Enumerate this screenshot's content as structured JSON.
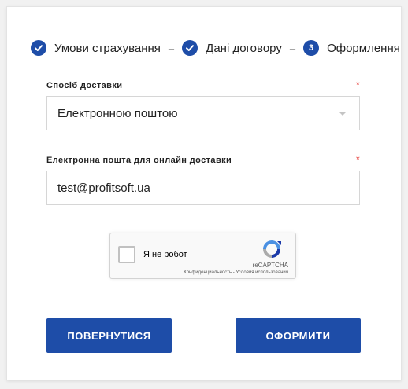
{
  "steps": [
    {
      "label": "Умови страхування",
      "state": "done"
    },
    {
      "label": "Дані договору",
      "state": "done"
    },
    {
      "label": "Оформлення",
      "state": "current",
      "number": "3"
    }
  ],
  "step_separator": "–",
  "delivery": {
    "label": "Спосіб доставки",
    "required_mark": "*",
    "value": "Електронною поштою"
  },
  "email": {
    "label": "Електронна пошта для онлайн доставки",
    "required_mark": "*",
    "value": "test@profitsoft.ua"
  },
  "recaptcha": {
    "label": "Я не робот",
    "brand": "reCAPTCHA",
    "links": "Конфиденциальность - Условия использования"
  },
  "buttons": {
    "back": "ПОВЕРНУТИСЯ",
    "submit": "ОФОРМИТИ"
  },
  "colors": {
    "accent": "#1e4da8",
    "required": "#e53935"
  }
}
